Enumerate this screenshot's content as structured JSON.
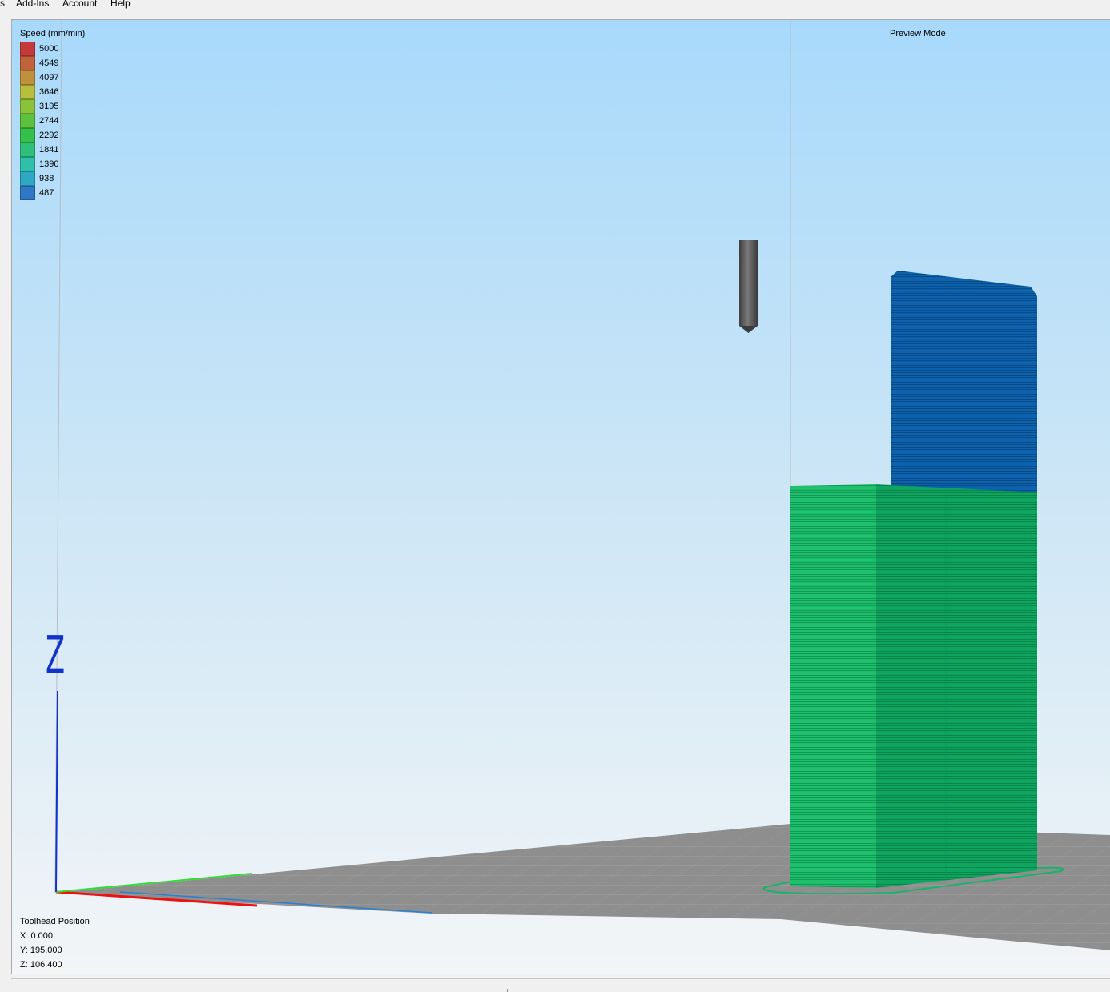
{
  "menubar": {
    "items": [
      {
        "label": "s"
      },
      {
        "label": "Add-Ins"
      },
      {
        "label": "Account"
      },
      {
        "label": "Help"
      }
    ]
  },
  "legend": {
    "title": "Speed (mm/min)",
    "items": [
      {
        "value": "5000",
        "color": "#c43a3a"
      },
      {
        "value": "4549",
        "color": "#c2623b"
      },
      {
        "value": "4097",
        "color": "#c0903c"
      },
      {
        "value": "3646",
        "color": "#b7bf3d"
      },
      {
        "value": "3195",
        "color": "#8ac23c"
      },
      {
        "value": "2744",
        "color": "#5cc13d"
      },
      {
        "value": "2292",
        "color": "#34c04a"
      },
      {
        "value": "1841",
        "color": "#2ec07a"
      },
      {
        "value": "1390",
        "color": "#2ec0a8"
      },
      {
        "value": "938",
        "color": "#2ea8c4"
      },
      {
        "value": "487",
        "color": "#2f78c8"
      }
    ]
  },
  "viewport": {
    "mode_label": "Preview Mode",
    "axis_label": "Z"
  },
  "toolhead": {
    "title": "Toolhead Position",
    "x": "X: 0.000",
    "y": "Y: 195.000",
    "z": "Z: 106.400"
  },
  "colors": {
    "sky_top": "#a8d9fb",
    "sky_bottom": "#f3f5f7",
    "bed": "#8c8c8c",
    "print_lower": "#18b567",
    "print_upper": "#0d5ea8",
    "nozzle": "#555555"
  }
}
